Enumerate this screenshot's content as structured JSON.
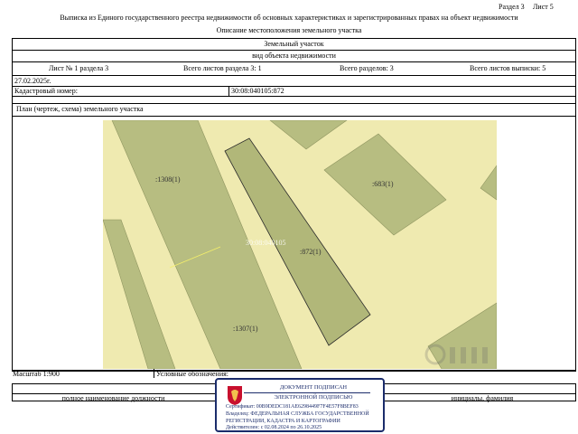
{
  "page_header": {
    "section": "Раздел 3",
    "sheet": "Лист 5",
    "title": "Выписка из Единого государственного реестра недвижимости об основных характеристиках и зарегистрированных правах на объект недвижимости",
    "subtitle": "Описание местоположения земельного участка"
  },
  "object": {
    "type": "Земельный участок",
    "type_caption": "вид объекта недвижимости"
  },
  "sheet_info": {
    "sheet_no": "Лист № 1 раздела 3",
    "sheets_in_section": "Всего листов раздела 3: 1",
    "sections": "Всего разделов: 3",
    "sheets_in_extract": "Всего листов выписки: 5"
  },
  "date": "27.02.2025г.",
  "cadastral": {
    "label": "Кадастровый номер:",
    "value": "30:08:040105:872"
  },
  "plan": {
    "title": "План (чертеж, схема) земельного участка",
    "labels": {
      "parcel_1308": ":1308(1)",
      "parcel_683": ":683(1)",
      "parcel_872": ":872(1)",
      "parcel_1307": ":1307(1)",
      "quarter": "30:08:040105"
    },
    "colors": {
      "background": "#efeab0",
      "neighbor": "#b7bd81",
      "neighbor_border": "#8f9560"
    }
  },
  "footer": {
    "scale": "Масштаб 1:900",
    "legend": "Условные обозначения:",
    "position_caption": "полное наименование должности",
    "name_caption": "инициалы, фамилия"
  },
  "stamp": {
    "line1": "ДОКУМЕНТ ПОДПИСАН",
    "line2": "ЭЛЕКТРОННОЙ ПОДПИСЬЮ",
    "certificate": "Сертификат: 00B9DEDC181AE6298449F7F4E57F8BEF83",
    "owner_1": "Владелец: ФЕДЕРАЛЬНАЯ СЛУЖБА ГОСУДАРСТВЕННОЙ",
    "owner_2": "РЕГИСТРАЦИИ, КАДАСТРА И КАРТОГРАФИИ",
    "validity": "Действителен: с 02.08.2024 по 26.10.2025",
    "emblem_icon": "eagle-emblem-icon"
  }
}
